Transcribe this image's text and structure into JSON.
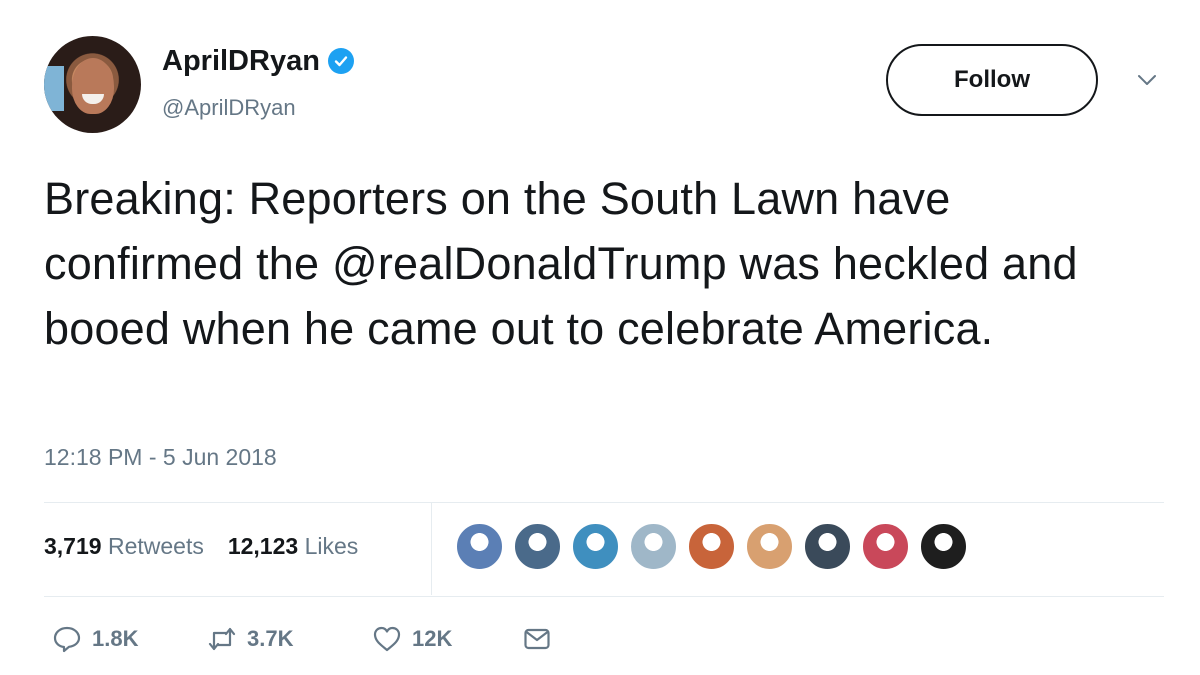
{
  "author": {
    "display_name": "AprilDRyan",
    "handle": "@AprilDRyan",
    "verified_icon": "verified-badge-icon",
    "verified_color": "#1da1f2"
  },
  "follow": {
    "label": "Follow"
  },
  "tweet": {
    "text": "Breaking: Reporters on the South Lawn have confirmed the @realDonaldTrump was heckled and booed when he came out to celebrate America.",
    "timestamp": "12:18 PM - 5 Jun 2018"
  },
  "stats": {
    "retweets_count": "3,719",
    "retweets_label": "Retweets",
    "likes_count": "12,123",
    "likes_label": "Likes"
  },
  "likers": [
    {
      "name": "liker-avatar-1",
      "color": "#5b7fb5"
    },
    {
      "name": "liker-avatar-2",
      "color": "#4a6a8a"
    },
    {
      "name": "liker-avatar-3",
      "color": "#3f8fbf"
    },
    {
      "name": "liker-avatar-4",
      "color": "#9fb7c8"
    },
    {
      "name": "liker-avatar-5",
      "color": "#c8643a"
    },
    {
      "name": "liker-avatar-6",
      "color": "#d8a070"
    },
    {
      "name": "liker-avatar-7",
      "color": "#3a4a5a"
    },
    {
      "name": "liker-avatar-8",
      "color": "#c9485a"
    },
    {
      "name": "liker-avatar-9",
      "color": "#1e1e1e"
    }
  ],
  "actions": {
    "reply_count": "1.8K",
    "retweet_count": "3.7K",
    "like_count": "12K"
  },
  "colors": {
    "text": "#14171a",
    "secondary": "#657786",
    "divider": "#e6ecf0"
  }
}
